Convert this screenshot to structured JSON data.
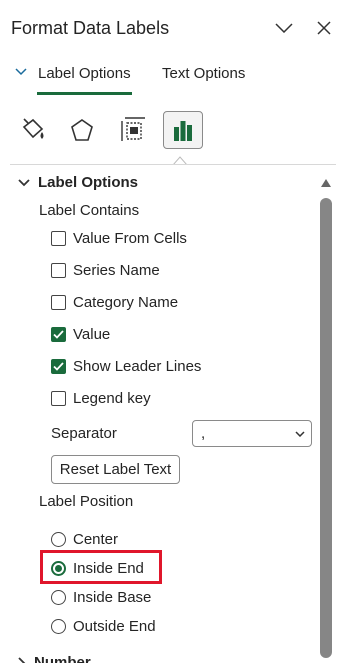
{
  "header": {
    "title": "Format Data Labels"
  },
  "tabs": [
    {
      "label": "Label Options",
      "selected": true
    },
    {
      "label": "Text Options",
      "selected": false
    }
  ],
  "category_icons": [
    {
      "name": "fill-line-icon",
      "selected": false
    },
    {
      "name": "effects-pentagon-icon",
      "selected": false
    },
    {
      "name": "size-properties-icon",
      "selected": false
    },
    {
      "name": "label-options-bar-chart-icon",
      "selected": true
    }
  ],
  "section": {
    "title": "Label Options"
  },
  "label_contains": {
    "heading": "Label Contains",
    "items": [
      {
        "label": "Value From Cells",
        "checked": false
      },
      {
        "label": "Series Name",
        "checked": false
      },
      {
        "label": "Category Name",
        "checked": false
      },
      {
        "label": "Value",
        "checked": true
      },
      {
        "label": "Show Leader Lines",
        "checked": true
      },
      {
        "label": "Legend key",
        "checked": false
      }
    ]
  },
  "separator": {
    "label": "Separator",
    "value": ","
  },
  "reset_button": {
    "label": "Reset Label Text"
  },
  "label_position": {
    "heading": "Label Position",
    "options": [
      {
        "label": "Center",
        "selected": false
      },
      {
        "label": "Inside End",
        "selected": true
      },
      {
        "label": "Inside Base",
        "selected": false
      },
      {
        "label": "Outside End",
        "selected": false
      }
    ]
  },
  "next_section": {
    "title": "Number"
  },
  "colors": {
    "accent": "#1a6b3c",
    "highlight": "#e0162b",
    "scrollbar": "#868686"
  }
}
